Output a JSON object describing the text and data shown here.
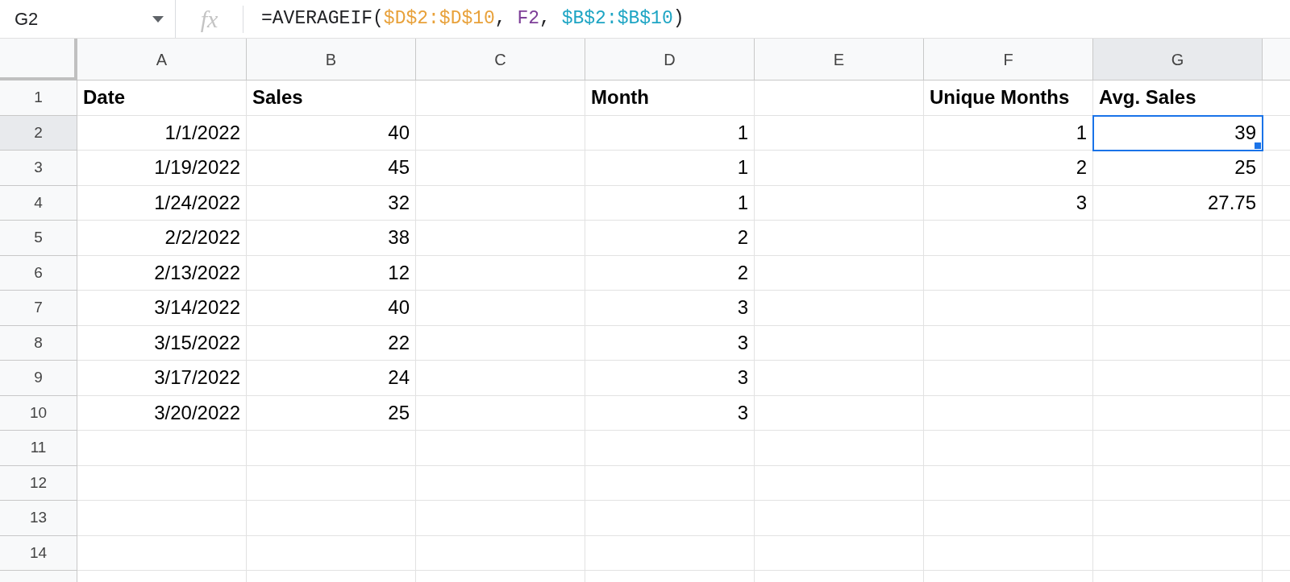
{
  "name_box": "G2",
  "function_label": "fx",
  "formula": [
    {
      "text": "=AVERAGEIF(",
      "color": "#202124"
    },
    {
      "text": "$D$2:$D$10",
      "color": "#e8a13a"
    },
    {
      "text": ", ",
      "color": "#202124"
    },
    {
      "text": "F2",
      "color": "#7e3f98"
    },
    {
      "text": ", ",
      "color": "#202124"
    },
    {
      "text": "$B$2:$B$10",
      "color": "#1ea5c4"
    },
    {
      "text": ")",
      "color": "#202124"
    }
  ],
  "columns": [
    {
      "label": "A",
      "selected": false
    },
    {
      "label": "B",
      "selected": false
    },
    {
      "label": "C",
      "selected": false
    },
    {
      "label": "D",
      "selected": false
    },
    {
      "label": "E",
      "selected": false
    },
    {
      "label": "F",
      "selected": false
    },
    {
      "label": "G",
      "selected": true
    }
  ],
  "rows": [
    {
      "number": "1",
      "selected": false,
      "kind": "header",
      "cells": [
        "Date",
        "Sales",
        "",
        "Month",
        "",
        "Unique Months",
        "Avg. Sales"
      ]
    },
    {
      "number": "2",
      "selected": true,
      "kind": "value",
      "cells": [
        "1/1/2022",
        "40",
        "",
        "1",
        "",
        "1",
        "39"
      ]
    },
    {
      "number": "3",
      "selected": false,
      "kind": "value",
      "cells": [
        "1/19/2022",
        "45",
        "",
        "1",
        "",
        "2",
        "25"
      ]
    },
    {
      "number": "4",
      "selected": false,
      "kind": "value",
      "cells": [
        "1/24/2022",
        "32",
        "",
        "1",
        "",
        "3",
        "27.75"
      ]
    },
    {
      "number": "5",
      "selected": false,
      "kind": "value",
      "cells": [
        "2/2/2022",
        "38",
        "",
        "2",
        "",
        "",
        ""
      ]
    },
    {
      "number": "6",
      "selected": false,
      "kind": "value",
      "cells": [
        "2/13/2022",
        "12",
        "",
        "2",
        "",
        "",
        ""
      ]
    },
    {
      "number": "7",
      "selected": false,
      "kind": "value",
      "cells": [
        "3/14/2022",
        "40",
        "",
        "3",
        "",
        "",
        ""
      ]
    },
    {
      "number": "8",
      "selected": false,
      "kind": "value",
      "cells": [
        "3/15/2022",
        "22",
        "",
        "3",
        "",
        "",
        ""
      ]
    },
    {
      "number": "9",
      "selected": false,
      "kind": "value",
      "cells": [
        "3/17/2022",
        "24",
        "",
        "3",
        "",
        "",
        ""
      ]
    },
    {
      "number": "10",
      "selected": false,
      "kind": "value",
      "cells": [
        "3/20/2022",
        "25",
        "",
        "3",
        "",
        "",
        ""
      ]
    },
    {
      "number": "11",
      "selected": false,
      "kind": "value",
      "cells": [
        "",
        "",
        "",
        "",
        "",
        "",
        ""
      ]
    },
    {
      "number": "12",
      "selected": false,
      "kind": "value",
      "cells": [
        "",
        "",
        "",
        "",
        "",
        "",
        ""
      ]
    },
    {
      "number": "13",
      "selected": false,
      "kind": "value",
      "cells": [
        "",
        "",
        "",
        "",
        "",
        "",
        ""
      ]
    },
    {
      "number": "14",
      "selected": false,
      "kind": "value",
      "cells": [
        "",
        "",
        "",
        "",
        "",
        "",
        ""
      ]
    }
  ]
}
